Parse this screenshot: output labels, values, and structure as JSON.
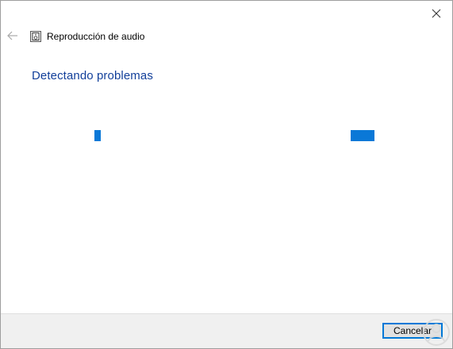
{
  "window": {
    "title": "Reproducción de audio",
    "close_icon": "close-icon",
    "back_icon": "back-arrow-icon",
    "app_icon": "speaker-troubleshooter-icon"
  },
  "main": {
    "heading": "Detectando problemas",
    "progress": {
      "type": "indeterminate-dots",
      "color": "#0a78d7"
    }
  },
  "footer": {
    "cancel_label": "Cancelar"
  },
  "colors": {
    "heading": "#123f9a",
    "accent": "#0078d7",
    "footer_bg": "#f0f0f0"
  }
}
